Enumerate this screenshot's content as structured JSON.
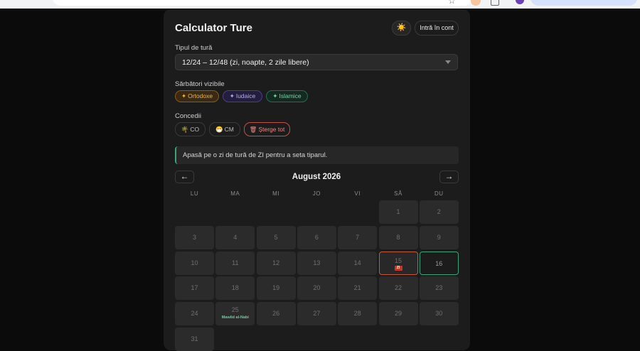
{
  "browser": {
    "url": "app.ro/calculator-ture"
  },
  "header": {
    "title": "Calculator Ture",
    "theme_icon": "sun-icon",
    "theme_glyph": "☀️",
    "login_label": "Intră în cont"
  },
  "shift_type": {
    "label": "Tipul de tură",
    "value": "12/24 – 12/48 (zi, noapte, 2 zile libere)"
  },
  "holidays": {
    "label": "Sărbători vizibile",
    "items": [
      {
        "label": "Ortodoxe",
        "color": "#f0b04a"
      },
      {
        "label": "Iudaice",
        "color": "#b7a8f5"
      },
      {
        "label": "Islamice",
        "color": "#73d6a6"
      }
    ]
  },
  "leave": {
    "label": "Concedii",
    "items": [
      {
        "label": "CO",
        "icon": "palm-tree-icon",
        "glyph": "🌴"
      },
      {
        "label": "CM",
        "icon": "sick-face-icon",
        "glyph": "😷"
      },
      {
        "label": "Șterge tot",
        "icon": "trash-icon",
        "glyph": "🗑"
      }
    ]
  },
  "notice": "Apasă pe o zi de tură de ZI pentru a seta tiparul.",
  "calendar": {
    "month": "August 2026",
    "prev": "←",
    "next": "→",
    "weekdays": [
      "LU",
      "MA",
      "MI",
      "JO",
      "VI",
      "SÂ",
      "DU"
    ],
    "days": [
      "1",
      "2",
      "3",
      "4",
      "5",
      "6",
      "7",
      "8",
      "9",
      "10",
      "11",
      "12",
      "13",
      "14",
      "15",
      "16",
      "17",
      "18",
      "19",
      "20",
      "21",
      "22",
      "23",
      "24",
      "25",
      "26",
      "27",
      "28",
      "29",
      "30",
      "31"
    ],
    "shift_day": "15",
    "shift_badge": "ZI",
    "today": "16",
    "holiday_day": "25",
    "holiday_name": "Mawlid al-Nabi"
  }
}
